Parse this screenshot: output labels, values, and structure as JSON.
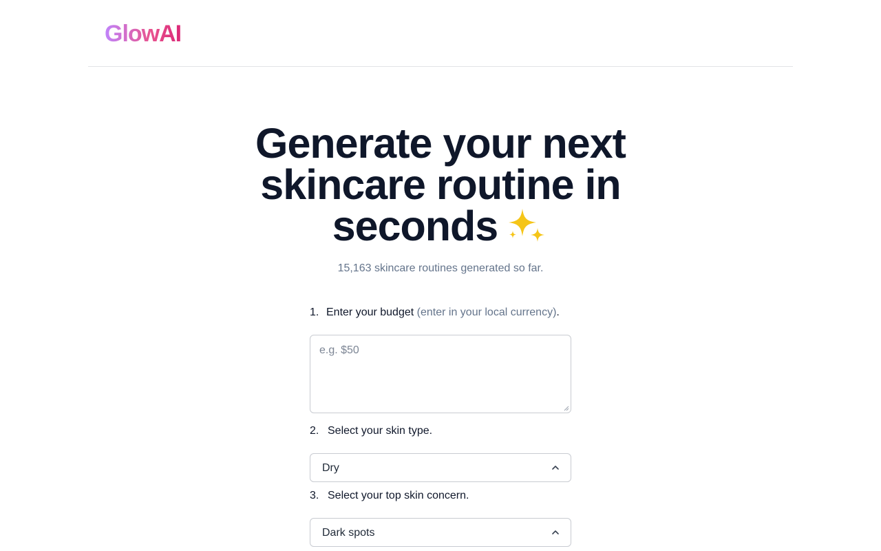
{
  "brand": {
    "name": "GlowAI",
    "gradient": [
      "#c084fc",
      "#e8548f",
      "#db2777"
    ]
  },
  "hero": {
    "line1": "Generate your next",
    "line2": "skincare routine in",
    "line3": "seconds",
    "emoji_icon": "sparkles-icon",
    "counter": "15,163 skincare routines generated so far."
  },
  "form": {
    "step1": {
      "number": "1.",
      "label": "Enter your budget",
      "hint": "(enter in your local currency)",
      "suffix": ".",
      "placeholder": "e.g. $50",
      "value": ""
    },
    "step2": {
      "number": "2.",
      "label": "Select your skin type.",
      "selected": "Dry"
    },
    "step3": {
      "number": "3.",
      "label": "Select your top skin concern.",
      "selected": "Dark spots"
    }
  },
  "colors": {
    "heading": "#0f172a",
    "muted": "#64748b",
    "border": "#c8cbd1",
    "sparkle": "#f5c518"
  }
}
